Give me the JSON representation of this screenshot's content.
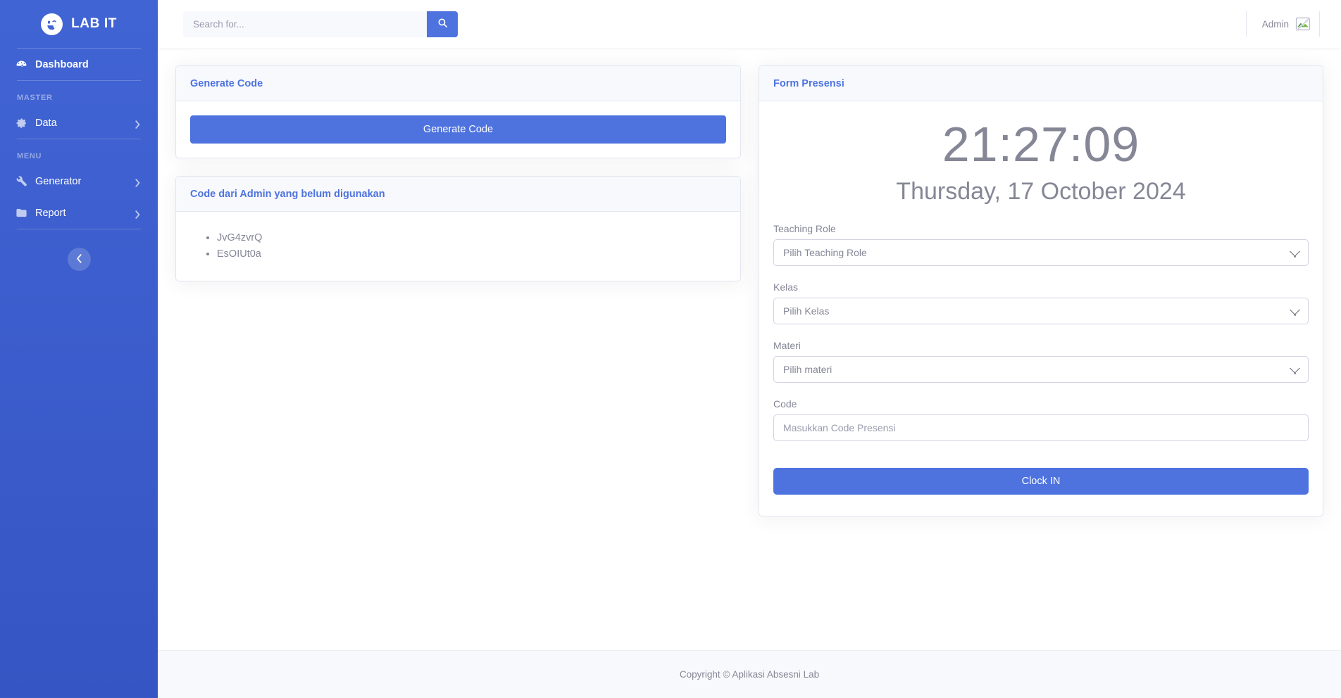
{
  "brand": {
    "text": "LAB IT",
    "logo_icon": "smiley-wink-icon"
  },
  "sidebar": {
    "dashboard": {
      "label": "Dashboard",
      "icon": "gauge-icon"
    },
    "headings": {
      "master": "MASTER",
      "menu": "MENU"
    },
    "items": [
      {
        "label": "Data",
        "icon": "gear-icon",
        "caret": "chevron-right-icon"
      },
      {
        "label": "Generator",
        "icon": "wrench-icon",
        "caret": "chevron-right-icon"
      },
      {
        "label": "Report",
        "icon": "folder-icon",
        "caret": "chevron-right-icon"
      }
    ],
    "toggle_icon": "chevron-left-icon"
  },
  "topbar": {
    "search": {
      "placeholder": "Search for...",
      "value": "",
      "button_icon": "search-icon"
    },
    "user": {
      "name": "Admin",
      "avatar_icon": "broken-image-icon"
    }
  },
  "cards": {
    "generate_code": {
      "title": "Generate Code",
      "button_label": "Generate Code"
    },
    "unused_codes": {
      "title": "Code dari Admin yang belum digunakan",
      "items": [
        "JvG4zvrQ",
        "EsOIUt0a"
      ]
    },
    "form_presensi": {
      "title": "Form Presensi",
      "clock_time": "21:27:09",
      "clock_date": "Thursday, 17 October 2024",
      "fields": [
        {
          "label": "Teaching Role",
          "type": "select",
          "selected": "Pilih Teaching Role",
          "options": [
            "Pilih Teaching Role"
          ]
        },
        {
          "label": "Kelas",
          "type": "select",
          "selected": "Pilih Kelas",
          "options": [
            "Pilih Kelas"
          ]
        },
        {
          "label": "Materi",
          "type": "select",
          "selected": "Pilih materi",
          "options": [
            "Pilih materi"
          ]
        },
        {
          "label": "Code",
          "type": "text",
          "value": "",
          "placeholder": "Masukkan Code Presensi"
        }
      ],
      "submit_label": "Clock IN"
    }
  },
  "footer": {
    "text": "Copyright © Aplikasi Absesni Lab"
  },
  "colors": {
    "sidebar_blue": "#3a5ccc",
    "accent_blue": "#4e73df",
    "card_header_bg": "#f8f9fc",
    "text_muted": "#858796",
    "border": "#e3e6f0"
  }
}
